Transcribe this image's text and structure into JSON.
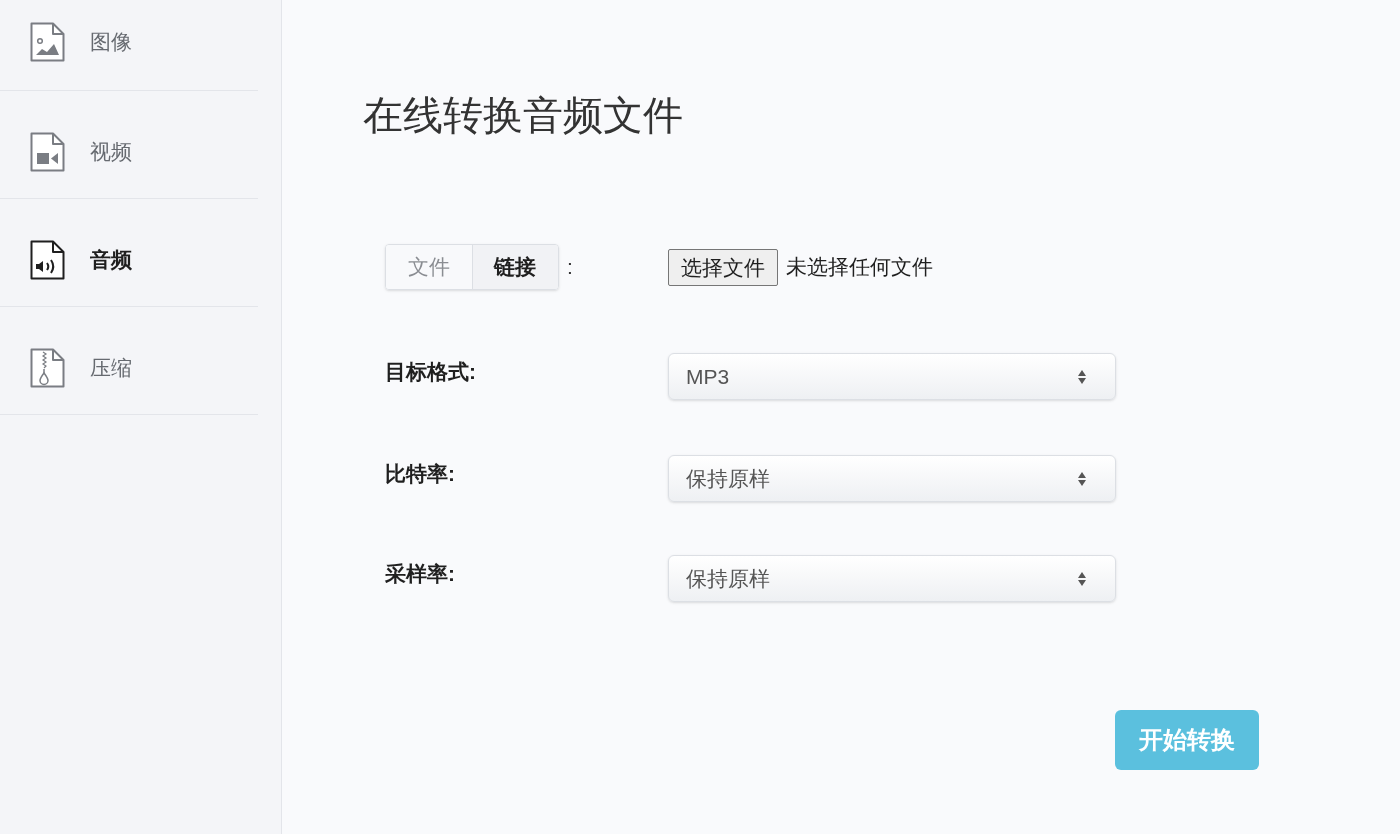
{
  "sidebar": {
    "items": [
      {
        "label": "图像",
        "kind": "image",
        "selected": false
      },
      {
        "label": "视频",
        "kind": "video",
        "selected": false
      },
      {
        "label": "音频",
        "kind": "audio",
        "selected": true
      },
      {
        "label": "压缩",
        "kind": "archive",
        "selected": false
      }
    ]
  },
  "title": "在线转换音频文件",
  "form": {
    "source_tabs": [
      {
        "label": "文件",
        "selected": false
      },
      {
        "label": "链接",
        "selected": true
      }
    ],
    "colon": ":",
    "file_button": "选择文件",
    "file_status": "未选择任何文件",
    "fields": [
      {
        "label": "目标格式:",
        "value": "MP3"
      },
      {
        "label": "比特率:",
        "value": "保持原样"
      },
      {
        "label": "采样率:",
        "value": "保持原样"
      }
    ],
    "submit_button": "开始转换"
  }
}
